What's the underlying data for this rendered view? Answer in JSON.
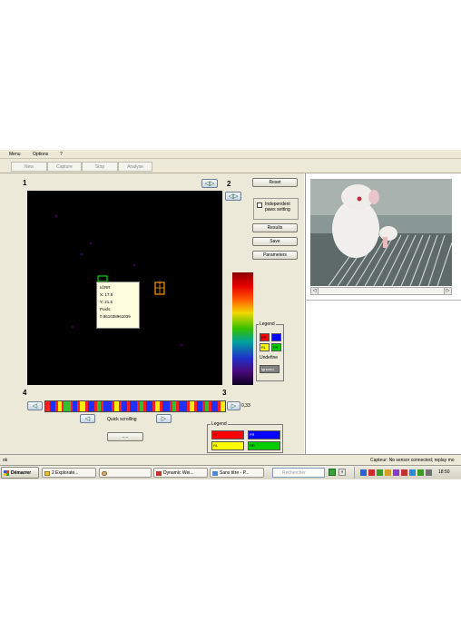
{
  "menu": {
    "items": [
      "Menu",
      "Options",
      "?"
    ]
  },
  "toolbar": {
    "buttons": [
      "New",
      "Capture",
      "Stop",
      "Analyse"
    ]
  },
  "panel_numbers": {
    "n1": "1",
    "n2": "2",
    "n3": "3",
    "n4": "4"
  },
  "buttons": {
    "reset": "Reset",
    "independent_paws": "Independent paws setting",
    "results": "Results",
    "save": "Save",
    "parameters": "Parameters",
    "more": "....."
  },
  "nav": {
    "prev": "◁▷",
    "next": "◁▷",
    "left": "◁",
    "right": "▷"
  },
  "tooltip": {
    "line1": "Id:RR",
    "line2": "X: 17.5",
    "line3": "Y: 21.5",
    "line4": "Poids:",
    "line5": "0.961038961039"
  },
  "paw_legend": {
    "title": "Legend",
    "rr": "RR",
    "rl": "RL",
    "fl": "FL",
    "fr": "FR",
    "undefine": "Undefine",
    "ignored": "Ignored"
  },
  "bottom_legend": {
    "title": "Legend",
    "fl": "FL",
    "fr": "FR",
    "rl": "RL",
    "rr": "RR"
  },
  "timeline": {
    "value": "0,33",
    "quick_scrolling": "Quick scrolling"
  },
  "status": {
    "left": "ok",
    "right": "Capteur: No sensor connected; replay mo"
  },
  "taskbar": {
    "start": "Démarrer",
    "tasks": [
      "2 Explorate...",
      "",
      "Dynamic Wei...",
      "Sans titre - P..."
    ],
    "search": "Rechercher",
    "clock": "18:50"
  },
  "colors": {
    "rr": "#ff0000",
    "rl": "#ffff00",
    "fl": "#ff0000",
    "fr": "#0000ff",
    "undefine_green": "#00cc00",
    "ignored": "#808080"
  }
}
